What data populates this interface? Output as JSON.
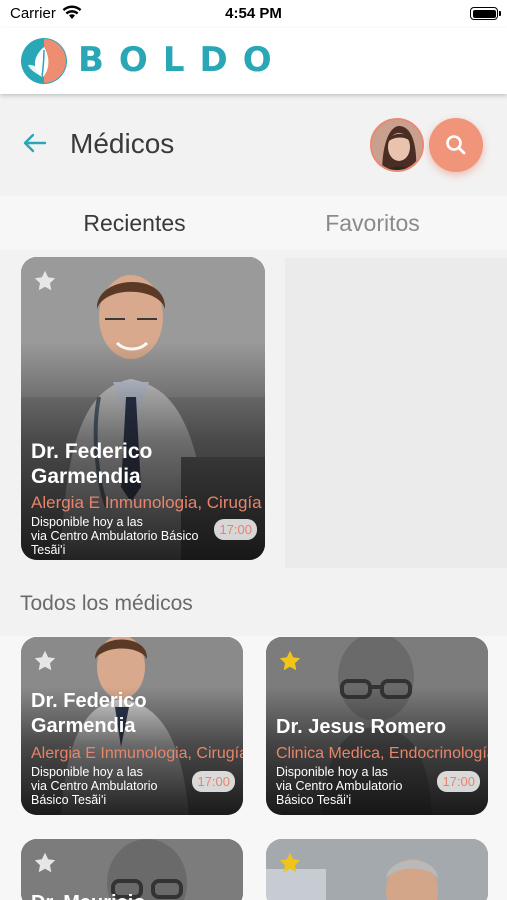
{
  "status_bar": {
    "carrier": "Carrier",
    "time": "4:54 PM"
  },
  "brand": {
    "name": "BOLDO"
  },
  "header": {
    "title": "Médicos"
  },
  "tabs": [
    {
      "label": "Recientes",
      "active": true
    },
    {
      "label": "Favoritos",
      "active": false
    }
  ],
  "recent": {
    "card": {
      "name_line1": "Dr. Federico",
      "name_line2": "Garmendia",
      "specialty": "Alergia E Inmunologia, Cirugía",
      "availability": "Disponible hoy a las",
      "location_line1": "via Centro Ambulatorio Básico",
      "location_line2": "Tesãi'i",
      "time": "17:00",
      "favorite": false
    }
  },
  "all_doctors": {
    "title": "Todos los médicos",
    "cards": [
      {
        "name_line1": "Dr. Federico",
        "name_line2": "Garmendia",
        "specialty": "Alergia E Inmunologia, Cirugía",
        "availability": "Disponible hoy a las",
        "location_line1": "via Centro Ambulatorio",
        "location_line2": "Básico Tesãi'i",
        "time": "17:00",
        "favorite": false
      },
      {
        "name_line1": "Dr. Jesus Romero",
        "name_line2": "",
        "specialty": "Clinica Medica, Endocrinología",
        "availability": "Disponible hoy a las",
        "location_line1": "via Centro Ambulatorio",
        "location_line2": "Básico Tesãi'i",
        "time": "17:00",
        "favorite": true
      },
      {
        "name_line1": "Dr. Mauricio",
        "favorite": false
      },
      {
        "name_line1": "",
        "favorite": true
      }
    ]
  },
  "colors": {
    "brand_teal": "#2aa7b6",
    "accent_coral": "#f0957a",
    "specialty_text": "#e8846a",
    "star_favorite": "#f0c419",
    "star_default": "#e6e6e6"
  },
  "icons": {
    "back": "arrow-left-icon",
    "search": "search-icon",
    "star": "star-icon",
    "wifi": "wifi-icon",
    "battery": "battery-icon",
    "logo": "leaf-logo-icon"
  }
}
